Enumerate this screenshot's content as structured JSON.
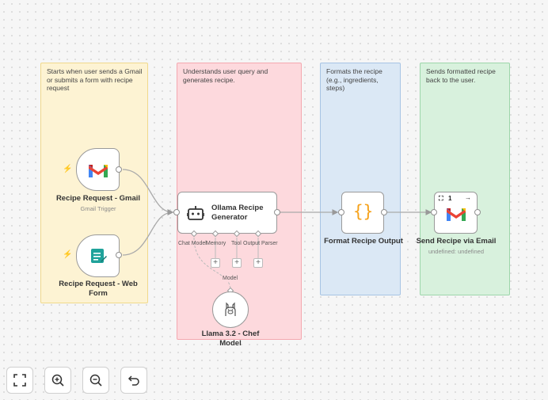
{
  "sticky_notes": {
    "trigger": "Starts when user sends a Gmail or submits a form with recipe request",
    "agent": "Understands user query and generates recipe.",
    "format": "Formats the recipe (e.g., ingredients, steps)",
    "send": "Sends formatted recipe back to the user."
  },
  "nodes": {
    "gmail_trigger": {
      "title": "Recipe Request - Gmail",
      "subtitle": "Gmail Trigger",
      "icon": "gmail-icon"
    },
    "web_form": {
      "title": "Recipe Request - Web Form",
      "icon": "form-icon"
    },
    "agent": {
      "title": "Ollama Recipe Generator",
      "icon": "robot-icon"
    },
    "formatter": {
      "title": "Format Recipe Output",
      "icon": "code-braces-icon"
    },
    "send": {
      "title": "Send Recipe via Email",
      "subtitle": "undefined: undefined",
      "icon": "gmail-icon",
      "toolbar_count": "1"
    },
    "llm": {
      "title": "Llama 3.2 - Chef Model",
      "icon": "ollama-icon"
    }
  },
  "agent_slots": {
    "chat_model": "Chat Model",
    "memory": "Memory",
    "tool": "Tool",
    "output_parser": "Output Parser",
    "model_pill": "Model"
  },
  "controls": {
    "fit": "fit-view-icon",
    "zoom_in": "zoom-in-icon",
    "zoom_out": "zoom-out-icon",
    "reset": "reset-icon"
  },
  "colors": {
    "accent_orange": "#ff6a3d",
    "gmail_red": "#ea4335",
    "form_teal": "#1fa29a",
    "brace_orange": "#f6a21b"
  }
}
